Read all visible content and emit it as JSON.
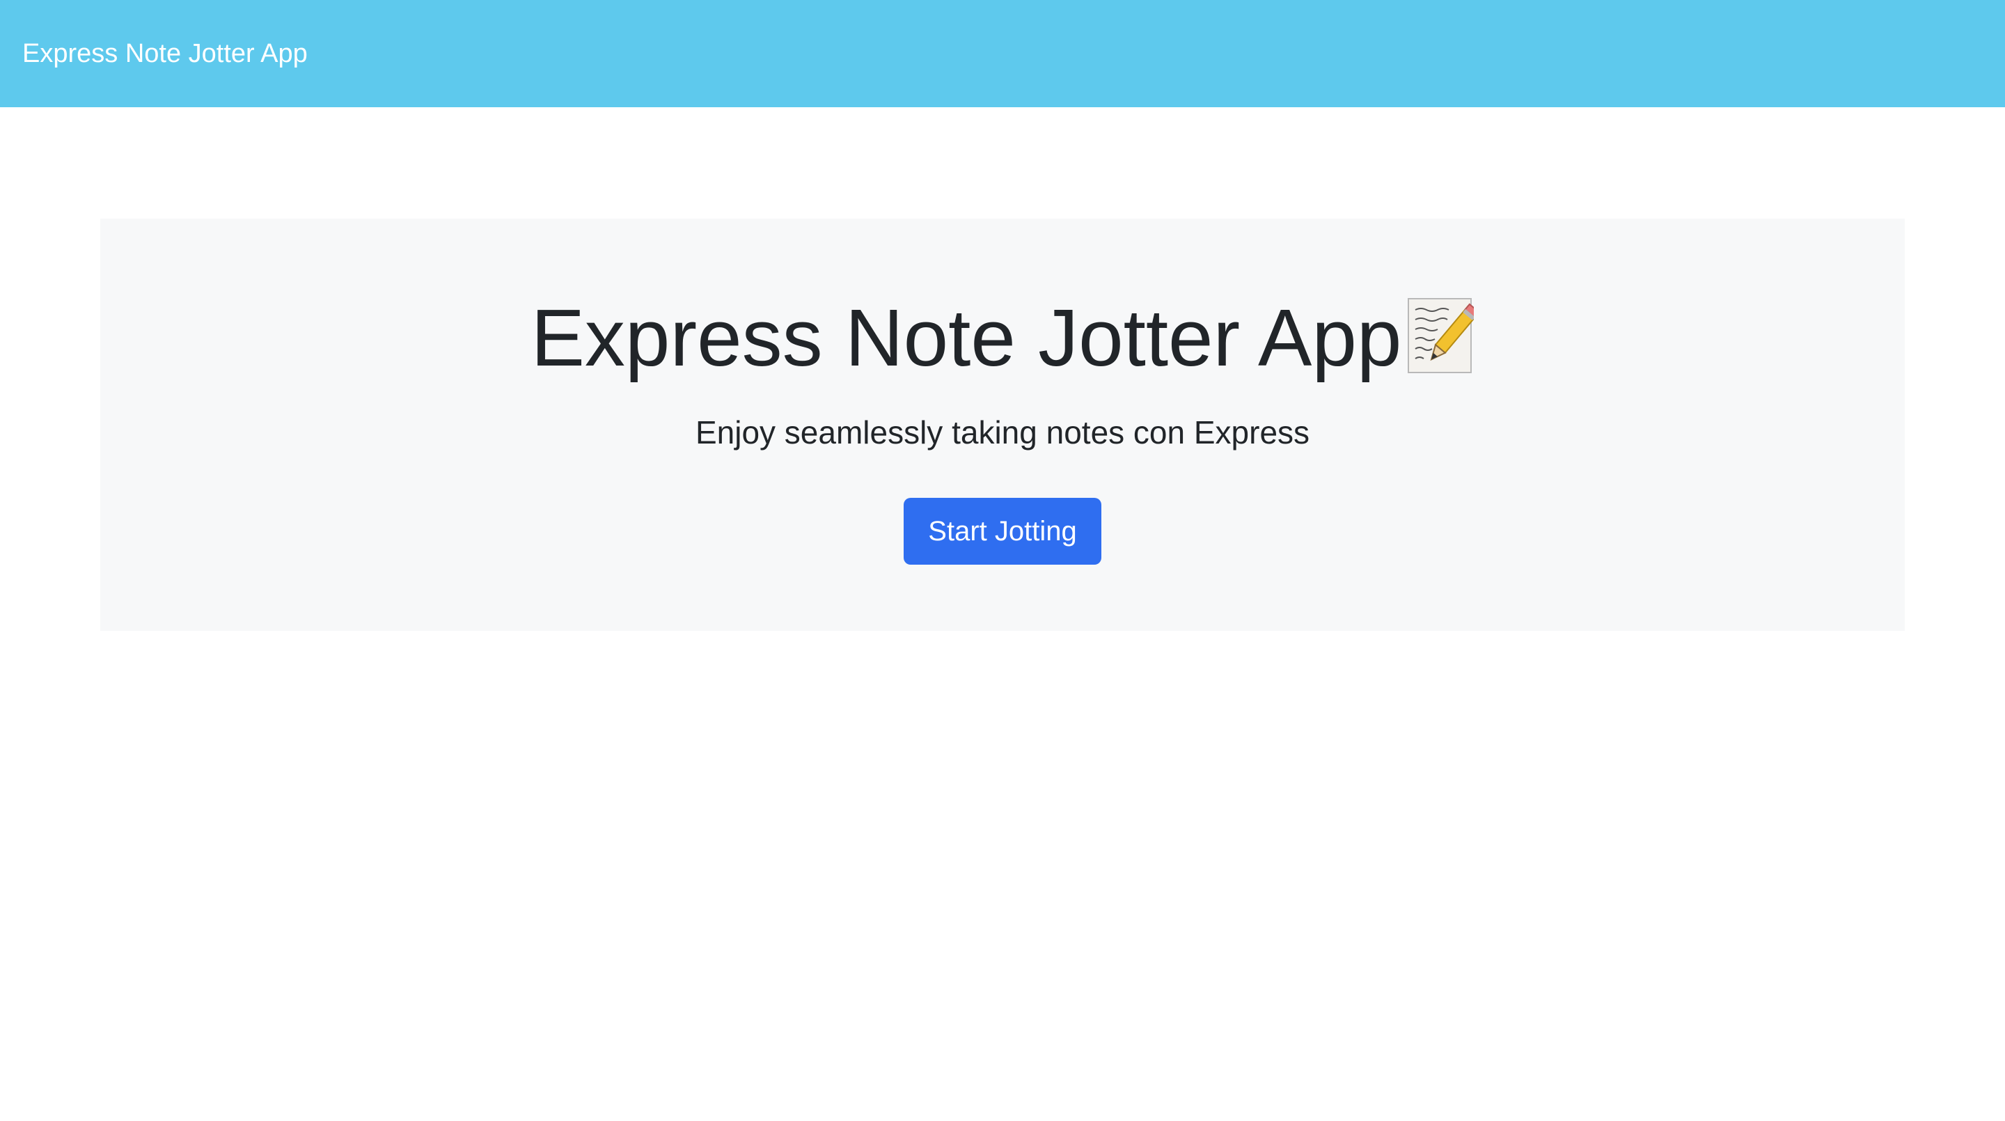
{
  "navbar": {
    "brand": "Express Note Jotter App",
    "background_color": "#5ec9ed"
  },
  "hero": {
    "title": "Express Note Jotter App",
    "title_icon": "memo-pencil-icon",
    "subtitle": "Enjoy seamlessly taking notes con Express",
    "button_label": "Start Jotting",
    "button_color": "#2f6ef0",
    "background_color": "#f7f8f9"
  }
}
